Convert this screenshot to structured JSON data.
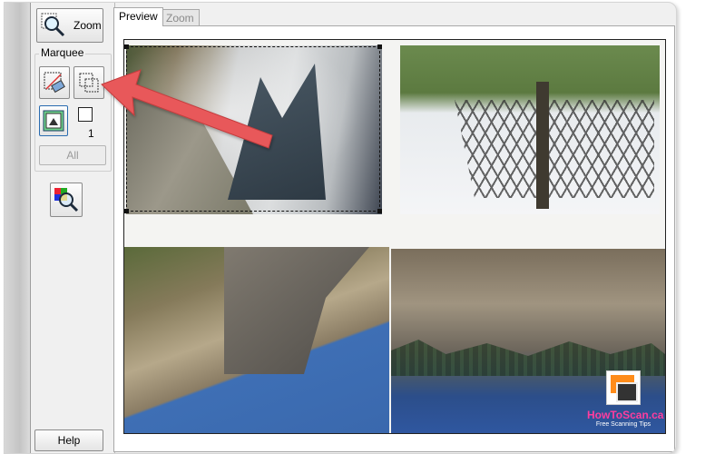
{
  "sidebar": {
    "zoom_label": "Zoom",
    "marquee_title": "Marquee",
    "marquee_count": "1",
    "all_label": "All",
    "help_label": "Help"
  },
  "tabs": [
    {
      "label": "Preview",
      "active": true
    },
    {
      "label": "Zoom",
      "active": false
    }
  ],
  "preview": {
    "watermark_name": "HowToScan.ca",
    "watermark_tagline": "Free Scanning Tips"
  },
  "colors": {
    "arrow": "#e8585a",
    "watermark": "#ff3d9e"
  }
}
